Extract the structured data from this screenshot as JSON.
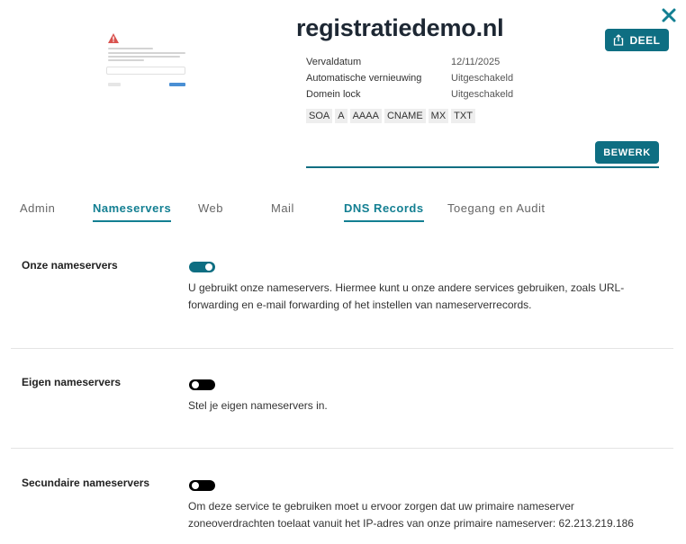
{
  "header": {
    "domain": "registratiedemo.nl",
    "share_label": "DEEL",
    "edit_label": "BEWERK"
  },
  "info": [
    {
      "key": "Vervaldatum",
      "value": "12/11/2025"
    },
    {
      "key": "Automatische vernieuwing",
      "value": "Uitgeschakeld"
    },
    {
      "key": "Domein lock",
      "value": "Uitgeschakeld"
    }
  ],
  "record_tags": [
    "SOA",
    "A",
    "AAAA",
    "CNAME",
    "MX",
    "TXT"
  ],
  "tabs": [
    {
      "label": "Admin",
      "style": "plain"
    },
    {
      "label": "Nameservers",
      "style": "active"
    },
    {
      "label": "Web",
      "style": "plain"
    },
    {
      "label": "Mail",
      "style": "plain"
    },
    {
      "label": "DNS Records",
      "style": "teal-underline"
    },
    {
      "label": "Toegang en Audit",
      "style": "plain"
    }
  ],
  "sections": [
    {
      "title": "Onze nameservers",
      "enabled": true,
      "description": "U gebruikt onze nameservers. Hiermee kunt u onze andere services gebruiken, zoals URL-forwarding en e-mail forwarding of het instellen van nameserverrecords."
    },
    {
      "title": "Eigen nameservers",
      "enabled": false,
      "description": "Stel je eigen nameservers in."
    },
    {
      "title": "Secundaire nameservers",
      "enabled": false,
      "description": "Om deze service te gebruiken moet u ervoor zorgen dat uw primaire nameserver zoneoverdrachten toelaat vanuit het IP-adres van onze primaire nameserver: 62.213.219.186"
    }
  ],
  "colors": {
    "accent": "#0e6e82",
    "tab_teal": "#137f92"
  }
}
